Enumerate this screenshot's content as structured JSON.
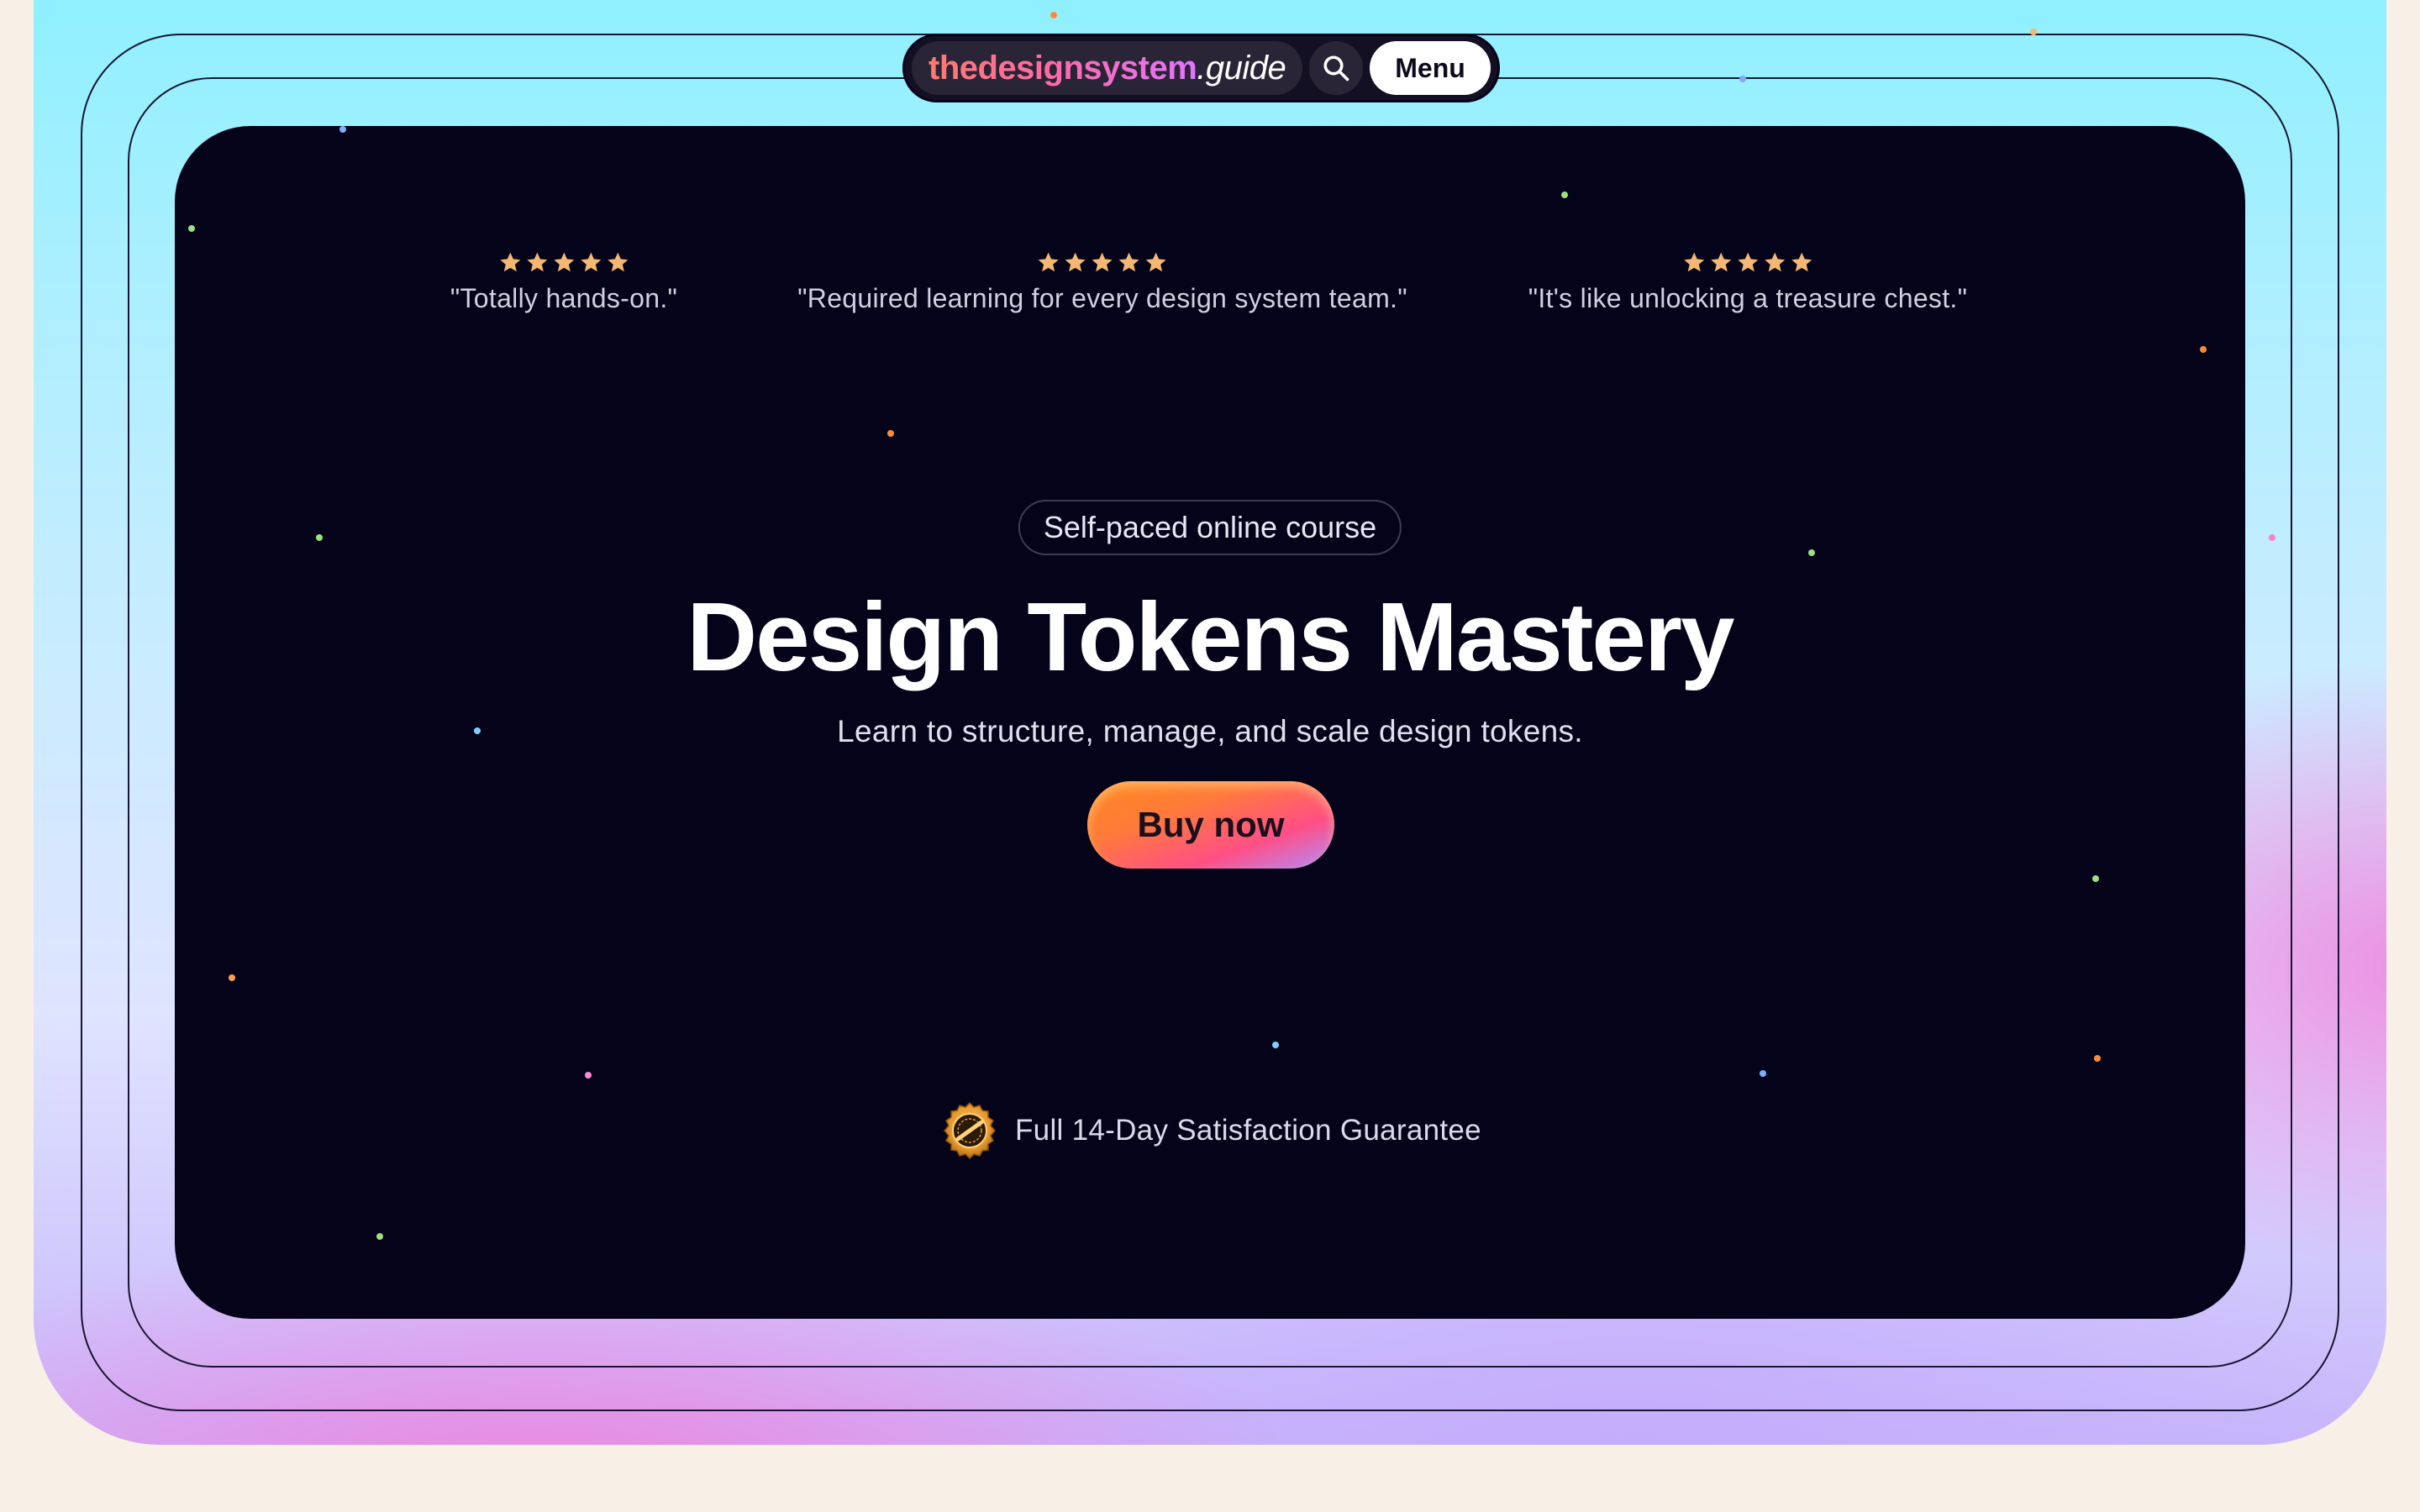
{
  "nav": {
    "logo_brand": "thedesignsystem",
    "logo_suffix": ".guide",
    "search_icon": "search-icon",
    "menu_label": "Menu"
  },
  "testimonials": [
    {
      "stars": 5,
      "quote": "\"Totally hands-on.\""
    },
    {
      "stars": 5,
      "quote": "\"Required learning for every design system team.\""
    },
    {
      "stars": 5,
      "quote": "\"It's like unlocking a treasure chest.\""
    }
  ],
  "hero": {
    "badge": "Self-paced online course",
    "title": "Design Tokens Mastery",
    "subtitle": "Learn to structure, manage, and scale design tokens.",
    "cta": "Buy now"
  },
  "guarantee": {
    "icon": "guarantee-seal-icon",
    "text": "Full 14-Day Satisfaction Guarantee"
  },
  "colors": {
    "page_background": "#f8efe7",
    "panel_background": "#05031a",
    "star": "#f5b872",
    "cta_gradient_start": "#ff8a1f",
    "cta_gradient_end": "#b18cff"
  }
}
